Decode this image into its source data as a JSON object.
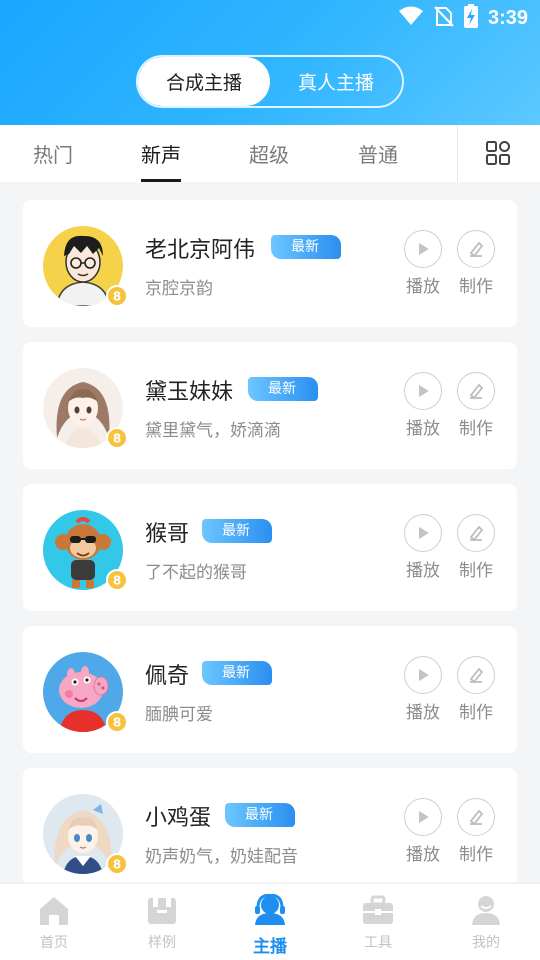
{
  "status_bar": {
    "time": "3:39"
  },
  "header": {
    "segments": [
      {
        "label": "合成主播",
        "active": true
      },
      {
        "label": "真人主播",
        "active": false
      }
    ]
  },
  "tabs": [
    {
      "label": "热门",
      "active": false
    },
    {
      "label": "新声",
      "active": true
    },
    {
      "label": "超级",
      "active": false
    },
    {
      "label": "普通",
      "active": false
    }
  ],
  "cards": [
    {
      "name": "老北京阿伟",
      "badge": "最新",
      "description": "京腔京韵",
      "play_label": "播放",
      "make_label": "制作",
      "avatar": "man-with-glasses-avatar"
    },
    {
      "name": "黛玉妹妹",
      "badge": "最新",
      "description": "黛里黛气，娇滴滴",
      "play_label": "播放",
      "make_label": "制作",
      "avatar": "anime-girl-avatar"
    },
    {
      "name": "猴哥",
      "badge": "最新",
      "description": "了不起的猴哥",
      "play_label": "播放",
      "make_label": "制作",
      "avatar": "monkey-avatar"
    },
    {
      "name": "佩奇",
      "badge": "最新",
      "description": "腼腆可爱",
      "play_label": "播放",
      "make_label": "制作",
      "avatar": "pig-avatar"
    },
    {
      "name": "小鸡蛋",
      "badge": "最新",
      "description": "奶声奶气，奶娃配音",
      "play_label": "播放",
      "make_label": "制作",
      "avatar": "sailor-girl-avatar"
    }
  ],
  "bottom_nav": [
    {
      "label": "首页",
      "icon": "home-icon",
      "active": false
    },
    {
      "label": "样例",
      "icon": "sample-icon",
      "active": false
    },
    {
      "label": "主播",
      "icon": "anchor-icon",
      "active": true
    },
    {
      "label": "工具",
      "icon": "toolbox-icon",
      "active": false
    },
    {
      "label": "我的",
      "icon": "profile-icon",
      "active": false
    }
  ],
  "colors": {
    "header": "#31b6ff",
    "accent": "#1e8ff0",
    "badge": "#2a8ff0"
  }
}
